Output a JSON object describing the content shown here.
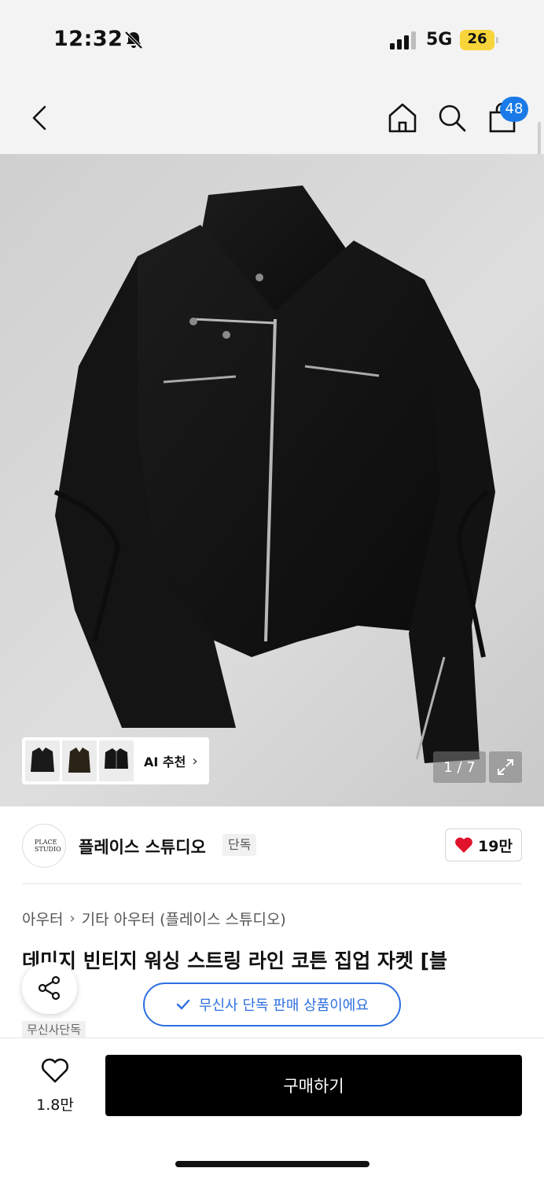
{
  "status_bar": {
    "time": "12:32",
    "network": "5G",
    "battery": "26"
  },
  "nav": {
    "cart_count": "48"
  },
  "product_image": {
    "alt": "Black cropped zip-up jacket",
    "page_counter": "1 / 7"
  },
  "ai_recommend": {
    "label": "AI 추천"
  },
  "brand": {
    "name": "플레이스 스튜디오",
    "tag": "단독",
    "logo_text": "PLACE STUDIO",
    "likes": "19만"
  },
  "breadcrumb": {
    "category": "아우터",
    "subcategory": "기타 아우터 (플레이스 스튜디오)"
  },
  "product": {
    "title": "데미지 빈티지 워싱 스트링 라인 코튼 집업 자켓 [블",
    "exclusive_notice": "무신사 단독 판매 상품이에요",
    "exclusive_tag": "무신사단독"
  },
  "bottom": {
    "wish_count": "1.8만",
    "buy_label": "구매하기"
  },
  "colors": {
    "accent": "#2d6fe0",
    "badge": "#1a7be8",
    "heart": "#e0122c",
    "battery": "#f7d53a"
  }
}
